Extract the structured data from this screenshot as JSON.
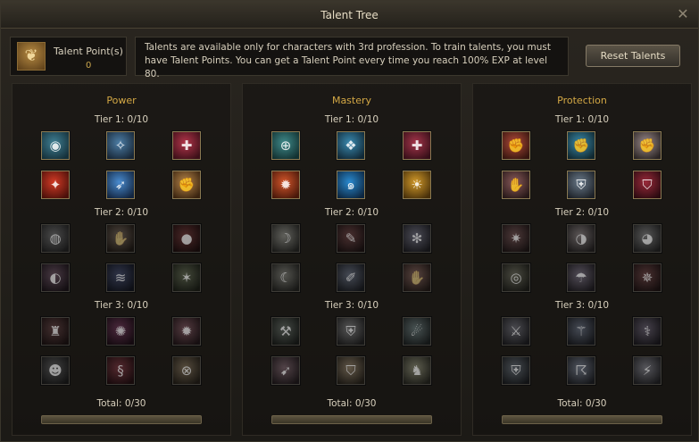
{
  "window": {
    "title": "Talent Tree",
    "close_icon": "✕"
  },
  "talent_points": {
    "label": "Talent Point(s)",
    "value": "0"
  },
  "info_text": "Talents are available only for characters with 3rd profession. To train talents, you must have Talent Points. You can get a Talent Point every time you reach 100% EXP at level 80.",
  "reset_button": "Reset Talents",
  "columns": [
    {
      "title": "Power",
      "tiers": [
        "Tier 1: 0/10",
        "Tier 2: 0/10",
        "Tier 3: 0/10"
      ],
      "total": "Total: 0/30",
      "icons": [
        {
          "name": "power-t1-skill1-icon",
          "glyph": "◉",
          "c1": "#3f7f93",
          "c2": "#15303a"
        },
        {
          "name": "power-t1-skill2-icon",
          "glyph": "✧",
          "c1": "#4d7ea6",
          "c2": "#172636"
        },
        {
          "name": "power-t1-skill3-icon",
          "glyph": "✚",
          "c1": "#b2354a",
          "c2": "#3c0f18"
        },
        {
          "name": "power-t1-skill4-icon",
          "glyph": "✦",
          "c1": "#d23a25",
          "c2": "#4a100a"
        },
        {
          "name": "power-t1-skill5-icon",
          "glyph": "➶",
          "c1": "#4a8cd0",
          "c2": "#122540"
        },
        {
          "name": "power-t1-skill6-icon",
          "glyph": "✊",
          "c1": "#b58448",
          "c2": "#3a2410"
        },
        {
          "name": "power-t2-skill1-icon",
          "glyph": "◍",
          "c1": "#6a6a6a",
          "c2": "#222"
        },
        {
          "name": "power-t2-skill2-icon",
          "glyph": "✋",
          "c1": "#7a5e46",
          "c2": "#24180f"
        },
        {
          "name": "power-t2-skill3-icon",
          "glyph": "●",
          "c1": "#9a2a2a",
          "c2": "#2b0b0b"
        },
        {
          "name": "power-t2-skill4-icon",
          "glyph": "◐",
          "c1": "#7a4a6a",
          "c2": "#22121d"
        },
        {
          "name": "power-t2-skill5-icon",
          "glyph": "≋",
          "c1": "#3a4a8a",
          "c2": "#10152a"
        },
        {
          "name": "power-t2-skill6-icon",
          "glyph": "✶",
          "c1": "#5a6a3a",
          "c2": "#1a2010"
        },
        {
          "name": "power-t3-skill1-icon",
          "glyph": "♜",
          "c1": "#7a3a3a",
          "c2": "#241010"
        },
        {
          "name": "power-t3-skill2-icon",
          "glyph": "✺",
          "c1": "#9a2a6a",
          "c2": "#2a0a1d"
        },
        {
          "name": "power-t3-skill3-icon",
          "glyph": "✹",
          "c1": "#9a4a5a",
          "c2": "#2a1218"
        },
        {
          "name": "power-t3-skill4-icon",
          "glyph": "☻",
          "c1": "#5a5a5a",
          "c2": "#1a1a1a"
        },
        {
          "name": "power-t3-skill5-icon",
          "glyph": "§",
          "c1": "#b02a3a",
          "c2": "#330a10"
        },
        {
          "name": "power-t3-skill6-icon",
          "glyph": "⊗",
          "c1": "#8a6a3a",
          "c2": "#281e10"
        }
      ]
    },
    {
      "title": "Mastery",
      "tiers": [
        "Tier 1: 0/10",
        "Tier 2: 0/10",
        "Tier 3: 0/10"
      ],
      "total": "Total: 0/30",
      "icons": [
        {
          "name": "mastery-t1-skill1-icon",
          "glyph": "⊕",
          "c1": "#3f8a8a",
          "c2": "#123030"
        },
        {
          "name": "mastery-t1-skill2-icon",
          "glyph": "❖",
          "c1": "#3a8ab0",
          "c2": "#102836"
        },
        {
          "name": "mastery-t1-skill3-icon",
          "glyph": "✚",
          "c1": "#a4354a",
          "c2": "#360f18"
        },
        {
          "name": "mastery-t1-skill4-icon",
          "glyph": "✹",
          "c1": "#d2552a",
          "c2": "#48180a"
        },
        {
          "name": "mastery-t1-skill5-icon",
          "glyph": "๑",
          "c1": "#2a8ad0",
          "c2": "#0c2640"
        },
        {
          "name": "mastery-t1-skill6-icon",
          "glyph": "☀",
          "c1": "#d29a2a",
          "c2": "#48300a"
        },
        {
          "name": "mastery-t2-skill1-icon",
          "glyph": "☽",
          "c1": "#8a8a7a",
          "c2": "#262620"
        },
        {
          "name": "mastery-t2-skill2-icon",
          "glyph": "✎",
          "c1": "#8a3a3a",
          "c2": "#241010"
        },
        {
          "name": "mastery-t2-skill3-icon",
          "glyph": "✻",
          "c1": "#6a6a8a",
          "c2": "#1c1c26"
        },
        {
          "name": "mastery-t2-skill4-icon",
          "glyph": "☾",
          "c1": "#7a7a6a",
          "c2": "#22221c"
        },
        {
          "name": "mastery-t2-skill5-icon",
          "glyph": "✐",
          "c1": "#5a6a8a",
          "c2": "#181c26"
        },
        {
          "name": "mastery-t2-skill6-icon",
          "glyph": "✋",
          "c1": "#9a5a4a",
          "c2": "#2a1812"
        },
        {
          "name": "mastery-t3-skill1-icon",
          "glyph": "⚒",
          "c1": "#5a6a5a",
          "c2": "#181e18"
        },
        {
          "name": "mastery-t3-skill2-icon",
          "glyph": "⛨",
          "c1": "#7a7a7a",
          "c2": "#202020"
        },
        {
          "name": "mastery-t3-skill3-icon",
          "glyph": "☄",
          "c1": "#5a7a7a",
          "c2": "#182222"
        },
        {
          "name": "mastery-t3-skill4-icon",
          "glyph": "➹",
          "c1": "#8a5a6a",
          "c2": "#26181d"
        },
        {
          "name": "mastery-t3-skill5-icon",
          "glyph": "⛉",
          "c1": "#9a7a4a",
          "c2": "#2a2012"
        },
        {
          "name": "mastery-t3-skill6-icon",
          "glyph": "♞",
          "c1": "#8a8a5a",
          "c2": "#262618"
        }
      ]
    },
    {
      "title": "Protection",
      "tiers": [
        "Tier 1: 0/10",
        "Tier 2: 0/10",
        "Tier 3: 0/10"
      ],
      "total": "Total: 0/30",
      "icons": [
        {
          "name": "protection-t1-skill1-icon",
          "glyph": "✊",
          "c1": "#b04a3a",
          "c2": "#36150f"
        },
        {
          "name": "protection-t1-skill2-icon",
          "glyph": "✊",
          "c1": "#3a8aaa",
          "c2": "#102830"
        },
        {
          "name": "protection-t1-skill3-icon",
          "glyph": "✊",
          "c1": "#9a8a8a",
          "c2": "#2a2424"
        },
        {
          "name": "protection-t1-skill4-icon",
          "glyph": "✋",
          "c1": "#8a5a5a",
          "c2": "#261818"
        },
        {
          "name": "protection-t1-skill5-icon",
          "glyph": "⛨",
          "c1": "#6a7a8a",
          "c2": "#1c2026"
        },
        {
          "name": "protection-t1-skill6-icon",
          "glyph": "⛉",
          "c1": "#9a2a3a",
          "c2": "#2a0a10"
        },
        {
          "name": "protection-t2-skill1-icon",
          "glyph": "✷",
          "c1": "#8a4a4a",
          "c2": "#261414"
        },
        {
          "name": "protection-t2-skill2-icon",
          "glyph": "◑",
          "c1": "#8a7a7a",
          "c2": "#262020"
        },
        {
          "name": "protection-t2-skill3-icon",
          "glyph": "◕",
          "c1": "#7a7a7a",
          "c2": "#222222"
        },
        {
          "name": "protection-t2-skill4-icon",
          "glyph": "◎",
          "c1": "#6a6a4a",
          "c2": "#1e1e14"
        },
        {
          "name": "protection-t2-skill5-icon",
          "glyph": "☂",
          "c1": "#7a6a8a",
          "c2": "#221c26"
        },
        {
          "name": "protection-t2-skill6-icon",
          "glyph": "✵",
          "c1": "#8a3a3a",
          "c2": "#261010"
        },
        {
          "name": "protection-t3-skill1-icon",
          "glyph": "⚔",
          "c1": "#6a6a7a",
          "c2": "#1c1c22"
        },
        {
          "name": "protection-t3-skill2-icon",
          "glyph": "⚚",
          "c1": "#5a6a8a",
          "c2": "#181c26"
        },
        {
          "name": "protection-t3-skill3-icon",
          "glyph": "⚕",
          "c1": "#6a5a7a",
          "c2": "#1c1822"
        },
        {
          "name": "protection-t3-skill4-icon",
          "glyph": "⛨",
          "c1": "#5a6a7a",
          "c2": "#181c22"
        },
        {
          "name": "protection-t3-skill5-icon",
          "glyph": "☈",
          "c1": "#6a7a9a",
          "c2": "#1c2029"
        },
        {
          "name": "protection-t3-skill6-icon",
          "glyph": "⚡",
          "c1": "#7a7a8a",
          "c2": "#202026"
        }
      ]
    }
  ]
}
